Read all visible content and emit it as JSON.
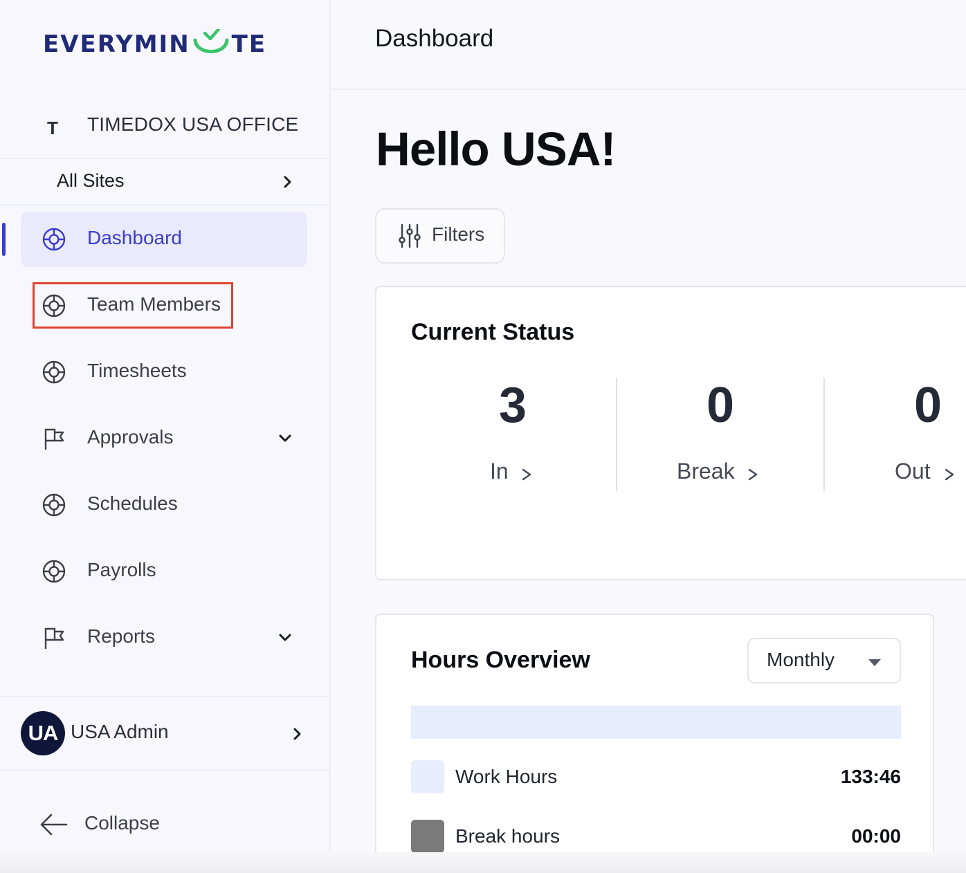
{
  "brand": {
    "logo_left": "EVERYMIN",
    "logo_right": "TE",
    "logo_color": "#1f2a78",
    "check_color": "#3bc46a"
  },
  "org": {
    "initial": "T",
    "name": "TIMEDOX USA OFFICE"
  },
  "sites": {
    "label": "All Sites"
  },
  "nav": {
    "items": [
      {
        "label": "Dashboard",
        "icon": "lifebuoy-icon",
        "active": true
      },
      {
        "label": "Team Members",
        "icon": "lifebuoy-icon",
        "highlighted": true
      },
      {
        "label": "Timesheets",
        "icon": "lifebuoy-icon"
      },
      {
        "label": "Approvals",
        "icon": "flag-icon",
        "expandable": true
      },
      {
        "label": "Schedules",
        "icon": "lifebuoy-icon"
      },
      {
        "label": "Payrolls",
        "icon": "lifebuoy-icon"
      },
      {
        "label": "Reports",
        "icon": "flag-icon",
        "expandable": true
      }
    ]
  },
  "user": {
    "initials": "UA",
    "name": "USA Admin"
  },
  "collapse": {
    "label": "Collapse"
  },
  "header": {
    "title": "Dashboard"
  },
  "greeting": "Hello USA!",
  "filters": {
    "label": "Filters"
  },
  "current_status": {
    "title": "Current Status",
    "stats": [
      {
        "value": "3",
        "label": "In"
      },
      {
        "value": "0",
        "label": "Break"
      },
      {
        "value": "0",
        "label": "Out"
      }
    ]
  },
  "hours_overview": {
    "title": "Hours Overview",
    "period": "Monthly",
    "bar_work_fraction": 1.0,
    "legend": [
      {
        "name": "Work Hours",
        "value": "133:46",
        "color": "#e8edfd"
      },
      {
        "name": "Break hours",
        "value": "00:00",
        "color": "#7a7a7a"
      }
    ]
  },
  "colors": {
    "accent": "#3b3ccc",
    "highlight_border": "#e0432f"
  }
}
